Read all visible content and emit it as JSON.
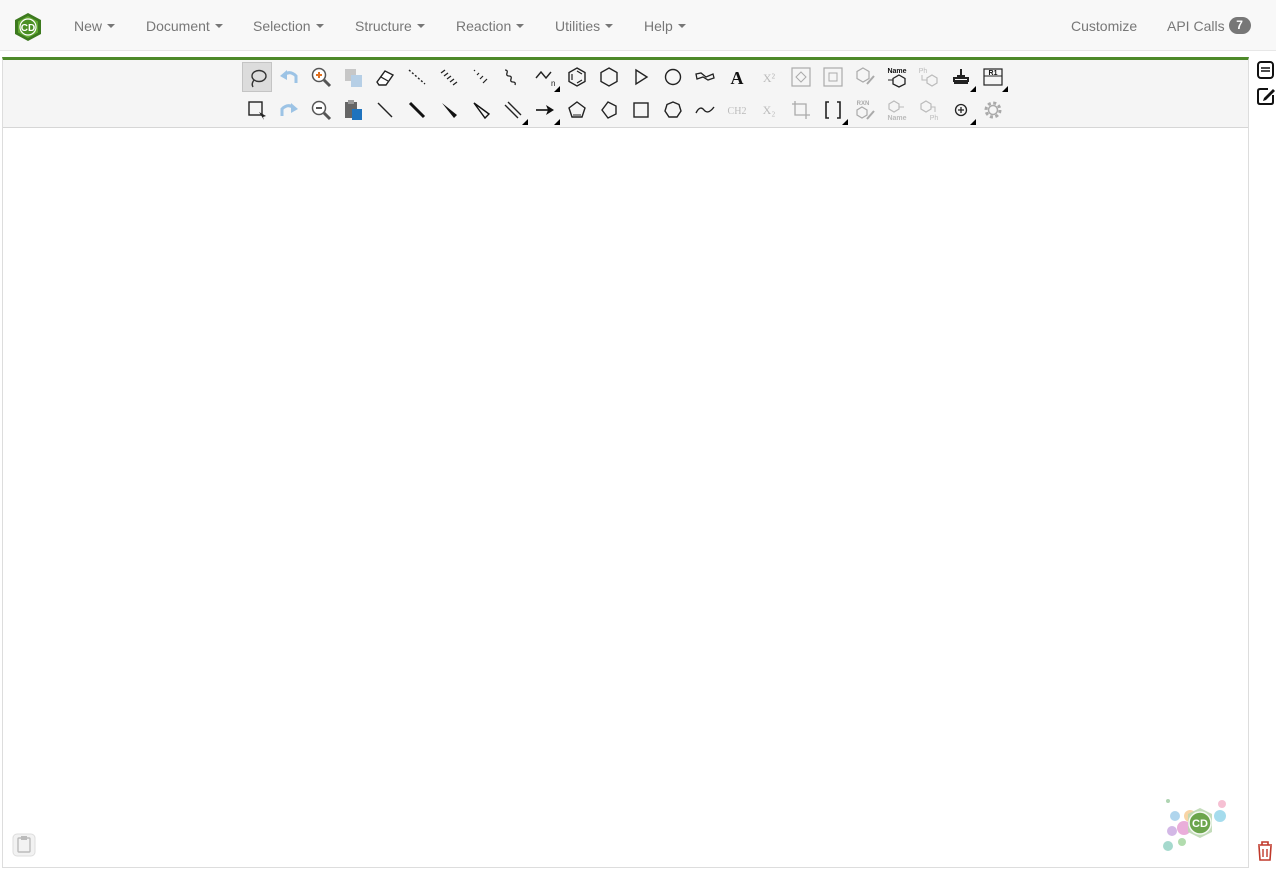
{
  "brand": {
    "logo_text": "CD",
    "colors": {
      "primary": "#4e8a2a",
      "nav_bg": "#f8f8f8"
    }
  },
  "nav": {
    "menus": [
      {
        "label": "New"
      },
      {
        "label": "Document"
      },
      {
        "label": "Selection"
      },
      {
        "label": "Structure"
      },
      {
        "label": "Reaction"
      },
      {
        "label": "Utilities"
      },
      {
        "label": "Help"
      }
    ],
    "customize": "Customize",
    "api_calls": "API Calls",
    "api_calls_count": "7"
  },
  "toolbar": {
    "row1": [
      {
        "icon": "lasso-icon",
        "state": "active"
      },
      {
        "icon": "undo-icon",
        "state": "disabled"
      },
      {
        "icon": "zoom-in-icon"
      },
      {
        "icon": "copy-icon",
        "state": "disabled"
      },
      {
        "icon": "eraser-icon"
      },
      {
        "icon": "dashed-bond-icon"
      },
      {
        "icon": "hashed-bond-icon"
      },
      {
        "icon": "hashed-wedge-bond-icon"
      },
      {
        "icon": "wavy-bond-icon"
      },
      {
        "icon": "chain-icon",
        "has_menu": true
      },
      {
        "icon": "benzene-icon"
      },
      {
        "icon": "cyclohexane-icon"
      },
      {
        "icon": "triangle-play-icon"
      },
      {
        "icon": "circle-icon"
      },
      {
        "icon": "wave-shape-icon"
      },
      {
        "icon": "text-icon",
        "glyph": "A"
      },
      {
        "icon": "superscript-icon",
        "glyph": "X²",
        "state": "disabled"
      },
      {
        "icon": "expand-structure-icon",
        "state": "disabled"
      },
      {
        "icon": "contract-structure-icon",
        "state": "disabled"
      },
      {
        "icon": "clean-structure-icon",
        "state": "disabled"
      },
      {
        "icon": "name-to-structure-icon",
        "glyph": "Name"
      },
      {
        "icon": "ph-structure-icon",
        "glyph": "Ph",
        "state": "disabled"
      },
      {
        "icon": "stamp-icon",
        "has_menu": true
      },
      {
        "icon": "r-group-icon",
        "glyph": "R1",
        "has_menu": true
      }
    ],
    "row2": [
      {
        "icon": "select-rect-icon"
      },
      {
        "icon": "redo-icon",
        "state": "disabled"
      },
      {
        "icon": "zoom-out-icon"
      },
      {
        "icon": "paste-icon"
      },
      {
        "icon": "single-bond-icon"
      },
      {
        "icon": "bold-bond-icon"
      },
      {
        "icon": "wedge-bond-icon"
      },
      {
        "icon": "hollow-wedge-bond-icon"
      },
      {
        "icon": "double-bond-icon",
        "has_menu": true
      },
      {
        "icon": "arrow-icon",
        "has_menu": true
      },
      {
        "icon": "pentagon-ring-icon"
      },
      {
        "icon": "cyclopentane-icon"
      },
      {
        "icon": "square-icon"
      },
      {
        "icon": "heptagon-icon"
      },
      {
        "icon": "curve-icon"
      },
      {
        "icon": "ch2-icon",
        "glyph": "CH2",
        "state": "disabled"
      },
      {
        "icon": "subscript-icon",
        "glyph": "X₂",
        "state": "disabled"
      },
      {
        "icon": "crop-icon",
        "state": "disabled"
      },
      {
        "icon": "bracket-icon",
        "glyph": "[ ]",
        "has_menu": true
      },
      {
        "icon": "clean-reaction-icon",
        "glyph": "RXN",
        "state": "disabled"
      },
      {
        "icon": "structure-to-name-icon",
        "glyph": "Name",
        "state": "disabled"
      },
      {
        "icon": "ph-expand-icon",
        "glyph": "Ph",
        "state": "disabled"
      },
      {
        "icon": "charge-plus-icon",
        "has_menu": true
      },
      {
        "icon": "settings-icon",
        "state": "disabled"
      }
    ]
  }
}
